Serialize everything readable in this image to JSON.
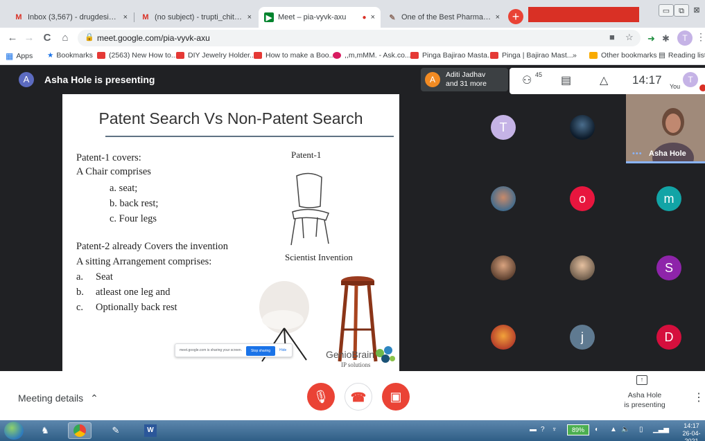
{
  "browser": {
    "tabs": [
      {
        "title": "Inbox (3,567) - drugdesign2@gm",
        "icon": "gmail-icon",
        "close": "×"
      },
      {
        "title": "(no subject) - trupti_chitre@aiss",
        "icon": "gmail-icon",
        "close": "×"
      },
      {
        "title": "Meet – pia-vyvk-axu",
        "icon": "meet-icon",
        "close": "×",
        "active": true
      },
      {
        "title": "One of the Best Pharmacy Colleg",
        "icon": "college-icon",
        "close": "×"
      }
    ],
    "new_tab": "+",
    "window_controls": {
      "minimize": "▭",
      "maximize": "⧉",
      "close": "⊠"
    },
    "nav": {
      "back": "←",
      "forward": "→",
      "reload": "C",
      "home": "⌂"
    },
    "url": "meet.google.com/pia-vyvk-axu",
    "profile_initial": "T",
    "menu": "⋮",
    "bookmarks": [
      {
        "label": "Apps",
        "type": "apps"
      },
      {
        "label": "Bookmarks",
        "type": "star"
      },
      {
        "label": "(2563) New How to...",
        "type": "yt"
      },
      {
        "label": "DIY Jewelry Holder...",
        "type": "yt"
      },
      {
        "label": "How to make a Boo...",
        "type": "yt"
      },
      {
        "label": ",,m,mMM. - Ask.co...",
        "type": "ask"
      },
      {
        "label": "Pinga Bajirao Masta...",
        "type": "yt"
      },
      {
        "label": "Pinga | Bajirao Mast...",
        "type": "yt"
      },
      {
        "label": "»",
        "type": "more"
      },
      {
        "label": "Other bookmarks",
        "type": "folder"
      },
      {
        "label": "Reading list",
        "type": "reading"
      }
    ]
  },
  "meet": {
    "presenter_initial": "A",
    "presenting_label": "Asha Hole is presenting",
    "others_initial": "A",
    "others_line1": "Aditi Jadhav",
    "others_line2": "and 31 more",
    "people_count": "45",
    "clock": "14:17",
    "you_label": "You",
    "you_initial": "T",
    "slide": {
      "title": "Patent Search Vs Non-Patent Search",
      "patent1_heading": "Patent-1 covers:",
      "chair_line": "A Chair comprises",
      "chair_items": [
        "a. seat;",
        "b. back rest;",
        "c. Four legs"
      ],
      "patent2_line": "Patent-2 already Covers the invention",
      "sitting_line": "A sitting Arrangement comprises:",
      "sitting_items": [
        {
          "letter": "a.",
          "text": "Seat"
        },
        {
          "letter": "b.",
          "text": "atleast one leg and"
        },
        {
          "letter": "c.",
          "text": "Optionally back rest"
        }
      ],
      "patent1_label": "Patent-1",
      "scientist_label": "Scientist Invention",
      "share_text": "meet.google.com is sharing your screen.",
      "stop_sharing": "Stop sharing",
      "hide": "Hide",
      "logo_name": "GenioBrain",
      "logo_sub": "IP solutions"
    },
    "tiles": [
      {
        "type": "letter",
        "initial": "T",
        "color": "#c5b3e6"
      },
      {
        "type": "photo",
        "name": "dark-photo"
      },
      {
        "type": "photo",
        "name": "man-photo"
      },
      {
        "type": "letter",
        "initial": "o",
        "color": "#e8163e"
      },
      {
        "type": "letter",
        "initial": "m",
        "color": "#12a4a6"
      },
      {
        "type": "photo",
        "name": "man2-photo"
      },
      {
        "type": "photo",
        "name": "woman-photo"
      },
      {
        "type": "letter",
        "initial": "S",
        "color": "#8e24aa"
      },
      {
        "type": "photo",
        "name": "cartoon-photo"
      },
      {
        "type": "letter",
        "initial": "j",
        "color": "#5f7a91"
      },
      {
        "type": "letter",
        "initial": "D",
        "color": "#d50f3d"
      }
    ],
    "asha_name": "Asha Hole",
    "meeting_details": "Meeting details",
    "presenting_note_line1": "Asha Hole",
    "presenting_note_line2": "is presenting",
    "more": "⋮"
  },
  "taskbar": {
    "battery": "89%",
    "time": "14:17",
    "date": "26-04-2021"
  },
  "colors": {
    "meet_red": "#ea4335",
    "meet_dark": "#202124",
    "link_blue": "#1a73e8"
  }
}
